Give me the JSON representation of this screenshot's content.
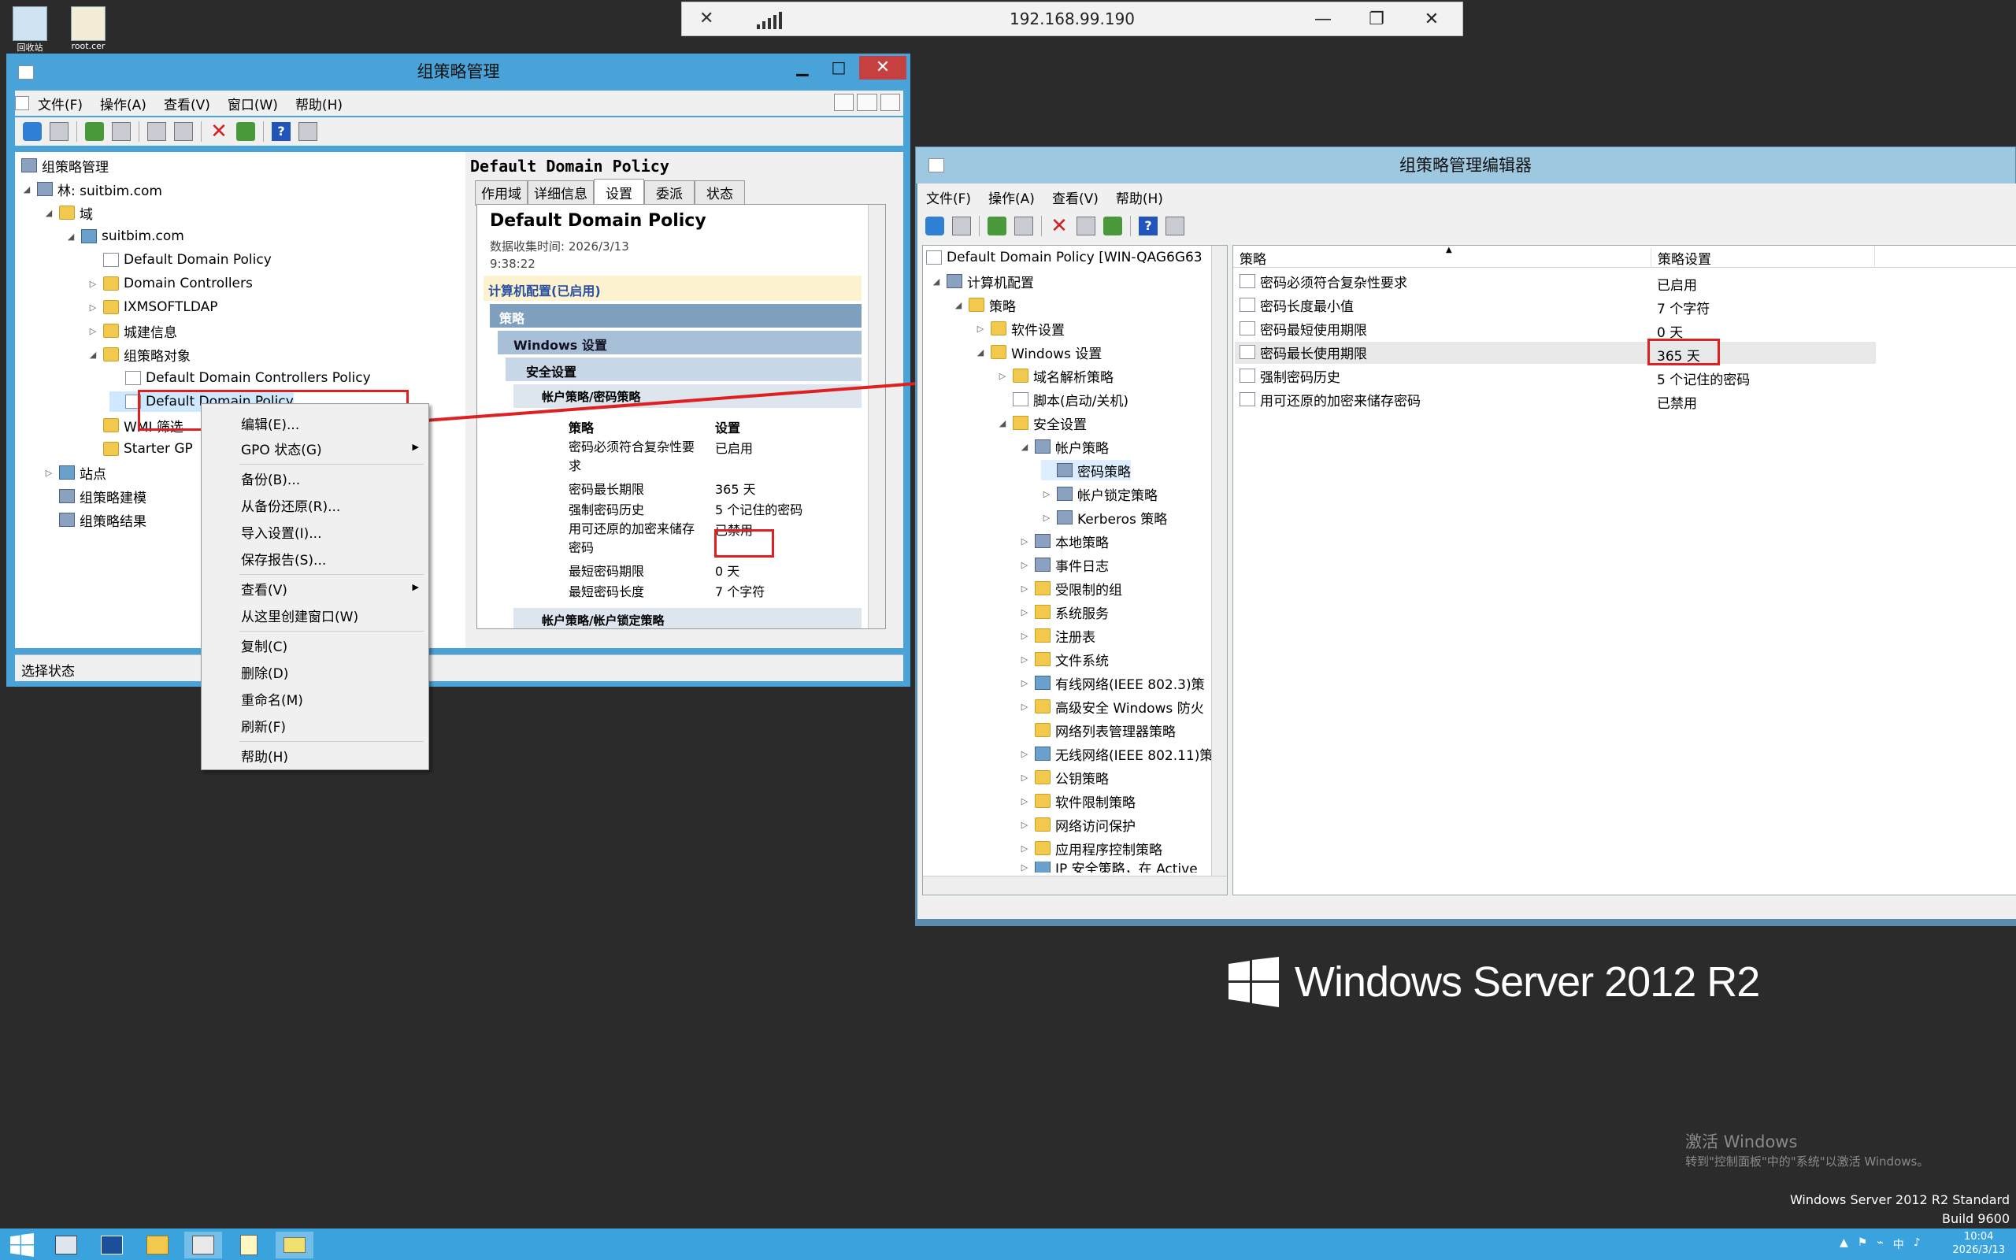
{
  "desktop": {
    "icons": [
      {
        "label": "回收站",
        "x": 0
      },
      {
        "label": "root.cer",
        "x": 1
      }
    ],
    "watermark": {
      "title": "激活 Windows",
      "subtitle": "转到\"控制面板\"中的\"系统\"以激活 Windows。"
    },
    "edition": {
      "line1": "Windows Server 2012 R2 Standard",
      "line2": "Build 9600"
    },
    "logo_text": "Windows Server 2012 R2"
  },
  "rdp": {
    "host": "192.168.99.190",
    "minimize": "—",
    "restore": "❐",
    "close": "✕"
  },
  "gpmc": {
    "title": "组策略管理",
    "menu": [
      "文件(F)",
      "操作(A)",
      "查看(V)",
      "窗口(W)",
      "帮助(H)"
    ],
    "tree": {
      "root": "组策略管理",
      "forest": "林: suitbim.com",
      "domains": "域",
      "domain": "suitbim.com",
      "ddp": "Default Domain Policy",
      "dc": "Domain Controllers",
      "ixm": "IXMSOFTLDAP",
      "city": "城建信息",
      "gpo": "组策略对象",
      "ddcp": "Default Domain Controllers Policy",
      "ddp2": "Default Domain Policy",
      "wmi": "WMI 筛选",
      "starter": "Starter GP",
      "sites": "站点",
      "modeling": "组策略建模",
      "results": "组策略结果"
    },
    "status": "选择状态",
    "detail": {
      "header": "Default Domain Policy",
      "tabs": [
        "作用域",
        "详细信息",
        "设置",
        "委派",
        "状态"
      ],
      "report_title": "Default Domain Policy",
      "collected_label": "数据收集时间: 2026/3/13",
      "collected_time": "9:38:22",
      "computer_config": "计算机配置(已启用)",
      "policies": "策略",
      "win_settings": "Windows 设置",
      "sec_settings": "安全设置",
      "account_pwd": "帐户策略/密码策略",
      "col_policy": "策略",
      "col_setting": "设置",
      "rows": [
        {
          "name": "密码必须符合复杂性要",
          "name2": "求",
          "value": "已启用"
        },
        {
          "name": "密码最长期限",
          "value": "365 天"
        },
        {
          "name": "强制密码历史",
          "value": "5 个记住的密码"
        },
        {
          "name": "用可还原的加密来储存",
          "name2": "密码",
          "value": "已禁用"
        },
        {
          "name": "最短密码期限",
          "value": "0 天"
        },
        {
          "name": "最短密码长度",
          "value": "7 个字符"
        }
      ],
      "lockout": "帐户策略/帐户锁定策略"
    }
  },
  "context_menu": {
    "items": [
      "编辑(E)...",
      "GPO 状态(G)",
      "备份(B)...",
      "从备份还原(R)...",
      "导入设置(I)...",
      "保存报告(S)...",
      "查看(V)",
      "从这里创建窗口(W)",
      "复制(C)",
      "删除(D)",
      "重命名(M)",
      "刷新(F)",
      "帮助(H)"
    ]
  },
  "editor": {
    "title": "组策略管理编辑器",
    "menu": [
      "文件(F)",
      "操作(A)",
      "查看(V)",
      "帮助(H)"
    ],
    "tree": {
      "root": "Default Domain Policy [WIN-QAG6G63",
      "computer": "计算机配置",
      "policies": "策略",
      "software": "软件设置",
      "windows": "Windows 设置",
      "dns": "域名解析策略",
      "scripts": "脚本(启动/关机)",
      "security": "安全设置",
      "account": "帐户策略",
      "password": "密码策略",
      "lockout": "帐户锁定策略",
      "kerberos": "Kerberos 策略",
      "local": "本地策略",
      "eventlog": "事件日志",
      "restricted": "受限制的组",
      "services": "系统服务",
      "registry": "注册表",
      "filesystem": "文件系统",
      "wired": "有线网络(IEEE 802.3)策",
      "firewall": "高级安全 Windows 防火",
      "netlist": "网络列表管理器策略",
      "wireless": "无线网络(IEEE 802.11)策",
      "pubkey": "公钥策略",
      "swrestrict": "软件限制策略",
      "nap": "网络访问保护",
      "applocker": "应用程序控制策略",
      "ipsec": "IP 安全策略，在 Active"
    },
    "columns": {
      "policy": "策略",
      "setting": "策略设置"
    },
    "rows": [
      {
        "name": "密码必须符合复杂性要求",
        "value": "已启用"
      },
      {
        "name": "密码长度最小值",
        "value": "7 个字符"
      },
      {
        "name": "密码最短使用期限",
        "value": "0 天"
      },
      {
        "name": "密码最长使用期限",
        "value": "365 天"
      },
      {
        "name": "强制密码历史",
        "value": "5 个记住的密码"
      },
      {
        "name": "用可还原的加密来储存密码",
        "value": "已禁用"
      }
    ]
  },
  "clock": {
    "time": "10:04",
    "date": "2026/3/13"
  }
}
